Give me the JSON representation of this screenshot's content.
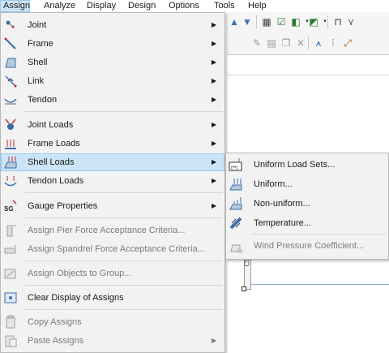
{
  "menubar": {
    "items": [
      {
        "label": "Assign",
        "active": true
      },
      {
        "label": "Analyze"
      },
      {
        "label": "Display"
      },
      {
        "label": "Design"
      },
      {
        "label": "Options"
      },
      {
        "label": "Tools"
      },
      {
        "label": "Help"
      }
    ]
  },
  "assign_menu": {
    "items": [
      {
        "label": "Joint",
        "icon": "joint-icon",
        "has_submenu": true
      },
      {
        "label": "Frame",
        "icon": "frame-icon",
        "has_submenu": true
      },
      {
        "label": "Shell",
        "icon": "shell-icon",
        "has_submenu": true
      },
      {
        "label": "Link",
        "icon": "link-icon",
        "has_submenu": true
      },
      {
        "label": "Tendon",
        "icon": "tendon-icon",
        "has_submenu": true
      },
      {
        "label": "Joint Loads",
        "icon": "joint-loads-icon",
        "has_submenu": true
      },
      {
        "label": "Frame Loads",
        "icon": "frame-loads-icon",
        "has_submenu": true
      },
      {
        "label": "Shell Loads",
        "icon": "shell-loads-icon",
        "has_submenu": true,
        "highlighted": true
      },
      {
        "label": "Tendon Loads",
        "icon": "tendon-loads-icon",
        "has_submenu": true
      },
      {
        "label": "Gauge Properties",
        "icon": "gauge-icon",
        "icon_text": "SG",
        "has_submenu": true
      },
      {
        "label": "Assign Pier Force Acceptance Criteria...",
        "icon": "pier-icon",
        "disabled": true
      },
      {
        "label": "Assign Spandrel Force Acceptance Criteria...",
        "icon": "spandrel-icon",
        "disabled": true
      },
      {
        "label": "Assign Objects to Group...",
        "icon": "group-icon",
        "disabled": true
      },
      {
        "label": "Clear Display of Assigns",
        "icon": "clear-display-icon"
      },
      {
        "label": "Copy Assigns",
        "icon": "copy-assigns-icon",
        "disabled": true
      },
      {
        "label": "Paste Assigns",
        "icon": "paste-assigns-icon",
        "disabled": true,
        "has_submenu": true
      }
    ]
  },
  "shell_loads_submenu": {
    "items": [
      {
        "label": "Uniform Load Sets...",
        "icon": "uniform-load-sets-icon"
      },
      {
        "label": "Uniform...",
        "icon": "uniform-icon"
      },
      {
        "label": "Non-uniform...",
        "icon": "non-uniform-icon"
      },
      {
        "label": "Temperature...",
        "icon": "temperature-icon"
      },
      {
        "label": "Wind Pressure Coefficient...",
        "icon": "wind-pressure-icon",
        "disabled": true
      }
    ]
  },
  "canvas": {
    "member_label": "C50dia"
  },
  "colors": {
    "menu_bg": "#f2f2f2",
    "highlight_bg": "#cce4f7",
    "highlight_border": "#99c9ef",
    "disabled_text": "#7b7b7b",
    "icon_blue": "#3a6fb0"
  }
}
